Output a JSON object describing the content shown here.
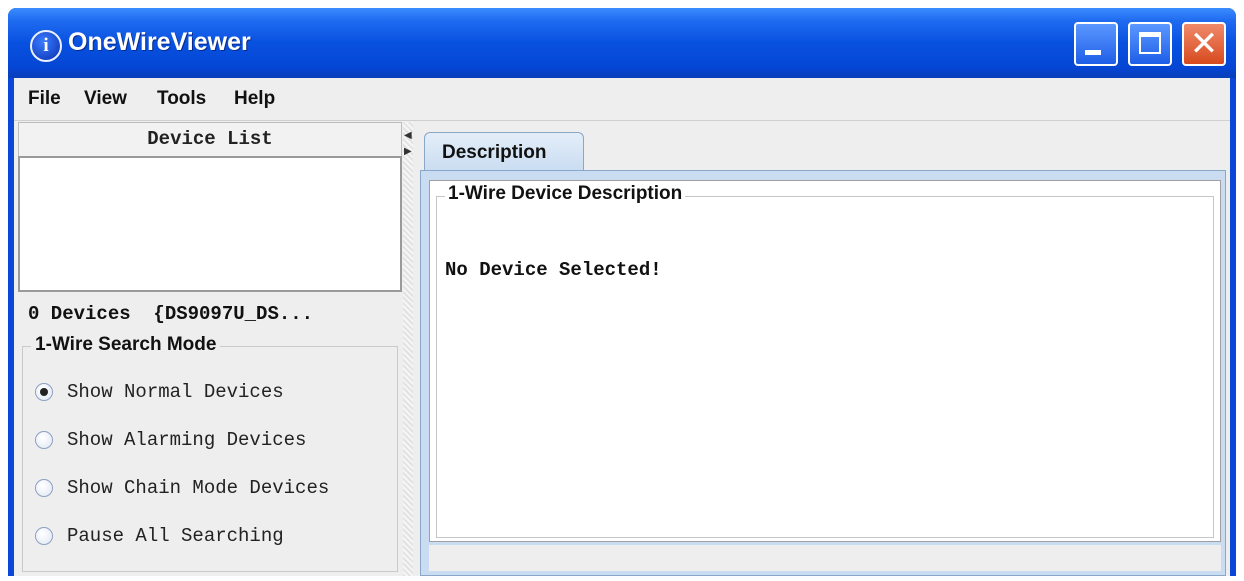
{
  "window": {
    "title": "OneWireViewer",
    "app_icon": "info-icon",
    "buttons": [
      "minimize",
      "maximize",
      "close"
    ]
  },
  "menu": [
    {
      "label": "File"
    },
    {
      "label": "View"
    },
    {
      "label": "Tools"
    },
    {
      "label": "Help"
    }
  ],
  "left_panel": {
    "header": "Device List",
    "devices_count": "0 Devices  {DS9097U_DS...",
    "search_mode": {
      "title": "1-Wire Search Mode",
      "options": [
        {
          "label": "Show Normal Devices",
          "checked": true
        },
        {
          "label": "Show Alarming Devices",
          "checked": false
        },
        {
          "label": "Show Chain Mode Devices",
          "checked": false
        },
        {
          "label": "Pause All Searching",
          "checked": false
        }
      ]
    }
  },
  "right_panel": {
    "tabs": [
      {
        "label": "Description"
      }
    ],
    "description_title": "1-Wire Device Description",
    "description_text": "No Device Selected!"
  },
  "colors": {
    "titlebar": "#0851e0",
    "close_button": "#d74a1e",
    "tab": "#c9dcf1",
    "window_bg": "#eeeeee"
  }
}
